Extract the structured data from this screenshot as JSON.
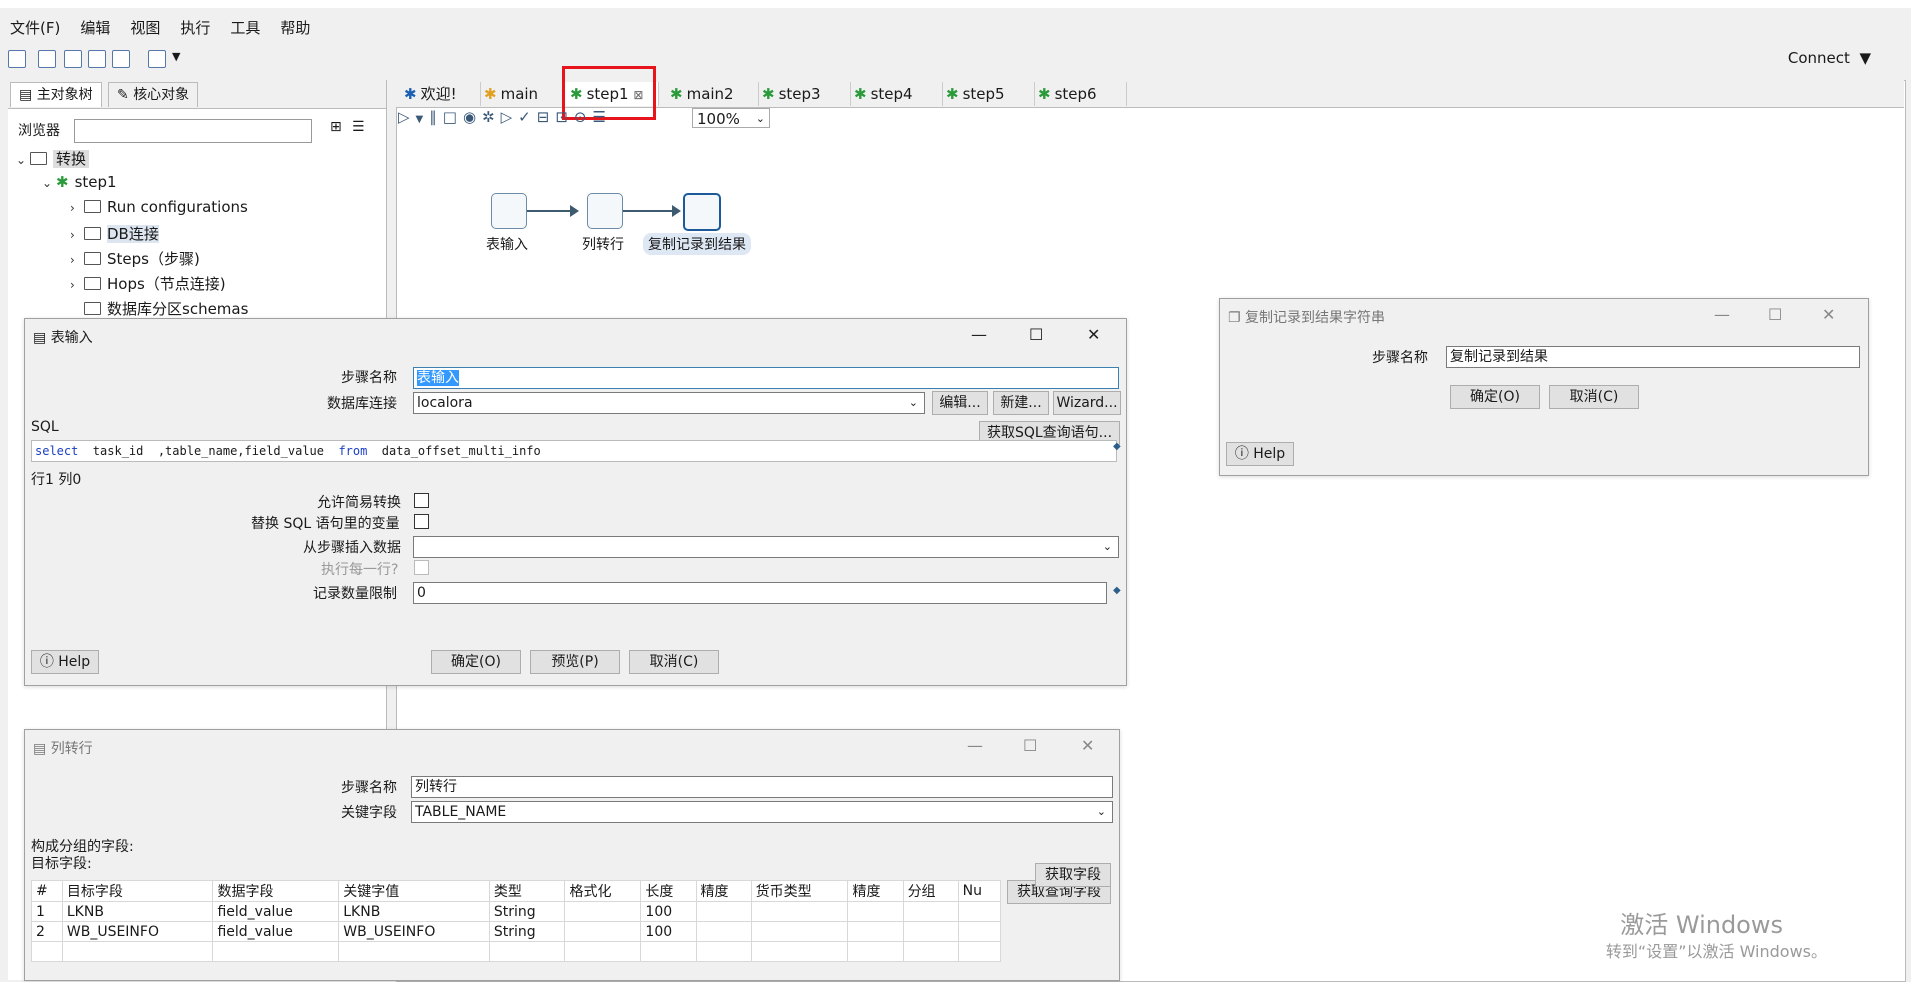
{
  "menu": [
    "文件(F)",
    "编辑",
    "视图",
    "执行",
    "工具",
    "帮助"
  ],
  "toolbar": {
    "connect": "Connect"
  },
  "left_panel": {
    "tabs": [
      "主对象树",
      "核心对象"
    ],
    "browser_label": "浏览器",
    "tree": {
      "root": "转换",
      "transform": "step1",
      "children": [
        "Run configurations",
        "DB连接",
        "Steps（步骤)",
        "Hops（节点连接)",
        "数据库分区schemas"
      ]
    }
  },
  "editor_tabs": [
    "欢迎!",
    "main",
    "step1",
    "main2",
    "step3",
    "step4",
    "step5",
    "step6"
  ],
  "zoom": "100%",
  "canvas": {
    "nodes": [
      "表输入",
      "列转行",
      "复制记录到结果"
    ]
  },
  "table_input_dialog": {
    "title": "表输入",
    "step_name_label": "步骤名称",
    "step_name_value": "表输入",
    "db_conn_label": "数据库连接",
    "db_conn_value": "localora",
    "btn_edit": "编辑...",
    "btn_new": "新建...",
    "btn_wizard": "Wizard...",
    "sql_label": "SQL",
    "btn_get_sql": "获取SQL查询语句...",
    "sql_kw_select": "select",
    "sql_text_mid": "  task_id  ,table_name,field_value  ",
    "sql_kw_from": "from",
    "sql_text_end": "  data_offset_multi_info",
    "position": "行1 列0",
    "allow_lazy": "允许简易转换",
    "replace_vars": "替换 SQL 语句里的变量",
    "insert_from_step": "从步骤插入数据",
    "exec_each_row": "执行每一行?",
    "limit_label": "记录数量限制",
    "limit_value": "0",
    "help": "Help",
    "ok": "确定(O)",
    "preview": "预览(P)",
    "cancel": "取消(C)"
  },
  "copy_rows_dialog": {
    "title": "复制记录到结果字符串",
    "step_name_label": "步骤名称",
    "step_name_value": "复制记录到结果",
    "ok": "确定(O)",
    "cancel": "取消(C)",
    "help": "Help"
  },
  "row_denorm_dialog": {
    "title": "列转行",
    "step_name_label": "步骤名称",
    "step_name_value": "列转行",
    "key_field_label": "关键字段",
    "key_field_value": "TABLE_NAME",
    "group_fields_label": "构成分组的字段:",
    "target_fields_label": "目标字段:",
    "btn_get_fields": "获取字段",
    "btn_get_lookup": "获取查询字段",
    "columns": [
      "#",
      "目标字段",
      "数据字段",
      "关键字值",
      "类型",
      "格式化",
      "长度",
      "精度",
      "货币类型",
      "精度",
      "分组",
      "Nu"
    ],
    "rows": [
      [
        "1",
        "LKNB",
        "field_value",
        "LKNB",
        "String",
        "",
        "100",
        "",
        "",
        "",
        "",
        ""
      ],
      [
        "2",
        "WB_USEINFO",
        "field_value",
        "WB_USEINFO",
        "String",
        "",
        "100",
        "",
        "",
        "",
        "",
        ""
      ]
    ]
  },
  "watermark": {
    "line1": "激活 Windows",
    "line2": "转到“设置”以激活 Windows。"
  }
}
